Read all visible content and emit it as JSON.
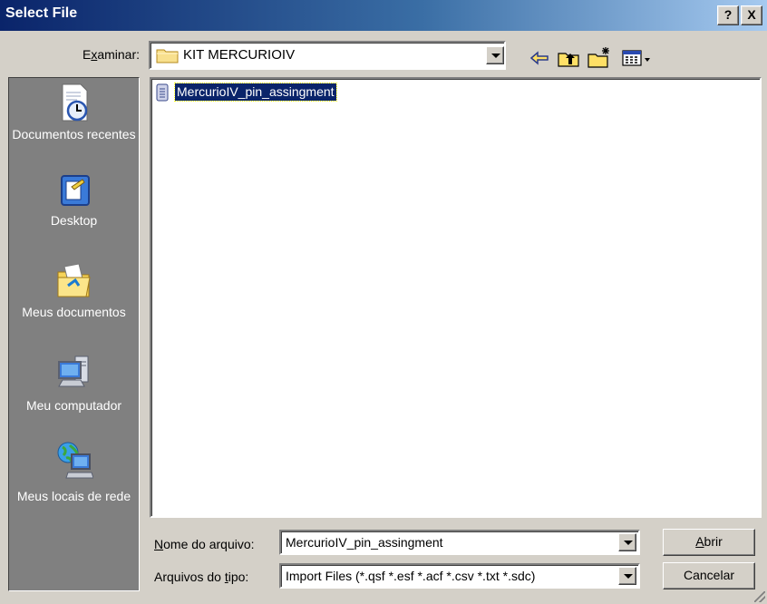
{
  "window": {
    "title": "Select File",
    "help_label": "?",
    "close_label": "X"
  },
  "lookin": {
    "label_prefix": "E",
    "label_accel": "x",
    "label_suffix": "aminar:",
    "value": "KIT MERCURIOIV"
  },
  "toolbar": {
    "icons": [
      "back-arrow-icon",
      "up-one-level-icon",
      "new-folder-icon",
      "view-menu-icon"
    ]
  },
  "places": [
    {
      "label": "Documentos recentes",
      "icon": "recent-documents-icon"
    },
    {
      "label": "Desktop",
      "icon": "desktop-icon"
    },
    {
      "label": "Meus documentos",
      "icon": "my-documents-icon"
    },
    {
      "label": "Meu computador",
      "icon": "my-computer-icon"
    },
    {
      "label": "Meus locais de rede",
      "icon": "network-places-icon"
    }
  ],
  "files": [
    {
      "name": "MercurioIV_pin_assingment",
      "selected": true,
      "icon": "text-file-icon"
    }
  ],
  "filename": {
    "label_accel": "N",
    "label_rest": "ome do arquivo:",
    "value": "MercurioIV_pin_assingment"
  },
  "filetype": {
    "label_prefix": "Arquivos do ",
    "label_accel": "t",
    "label_suffix": "ipo:",
    "value": "Import Files (*.qsf *.esf *.acf *.csv *.txt *.sdc)"
  },
  "buttons": {
    "open_accel": "A",
    "open_rest": "brir",
    "cancel": "Cancelar"
  },
  "colors": {
    "titlebar_start": "#0a246a",
    "titlebar_end": "#a6caf0",
    "selection": "#0a246a",
    "places_bg": "#808080",
    "dialog_bg": "#d4d0c8"
  }
}
